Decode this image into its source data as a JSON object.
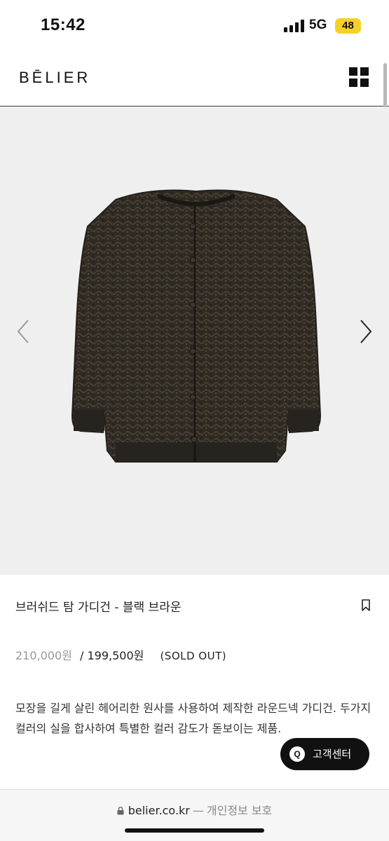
{
  "status_bar": {
    "time": "15:42",
    "network": "5G",
    "battery": "48",
    "battery_color": "#f5d02a"
  },
  "header": {
    "logo": "BĒLIER",
    "menu_icon": "grid-menu-icon"
  },
  "gallery": {
    "prev_icon": "chevron-left-icon",
    "next_icon": "chevron-right-icon",
    "background": "#efefef"
  },
  "product": {
    "title": "브러쉬드 탐 가디건 - 블랙 브라운",
    "original_price": "210,000원",
    "sale_price": "/ 199,500원",
    "status": "(SOLD OUT)",
    "description": "모장을 길게 살린 헤어리한 원사를 사용하여 제작한 라운드넥 가디건. 두가지 컬러의 실을 합사하여 특별한 컬러 감도가 돋보이는 제품."
  },
  "cs_button": {
    "icon_text": "Q",
    "label": "고객센터"
  },
  "browser": {
    "domain": "belier.co.kr",
    "separator": "—",
    "page": "개인정보 보호"
  }
}
